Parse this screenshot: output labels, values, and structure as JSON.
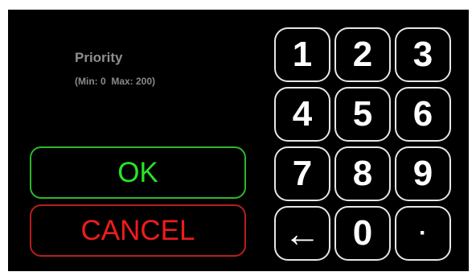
{
  "field": {
    "title": "Priority",
    "range": "(Min: 0  Max: 200)"
  },
  "actions": {
    "ok_label": "OK",
    "cancel_label": "CANCEL"
  },
  "keypad": {
    "keys": [
      "1",
      "2",
      "3",
      "4",
      "5",
      "6",
      "7",
      "8",
      "9",
      "←",
      "0",
      "·"
    ]
  },
  "colors": {
    "background": "#000000",
    "ok": "#27e427",
    "cancel": "#ee1c1c",
    "key_border": "#e6e6e6"
  },
  "icons": {
    "backspace": "left-arrow-icon"
  }
}
